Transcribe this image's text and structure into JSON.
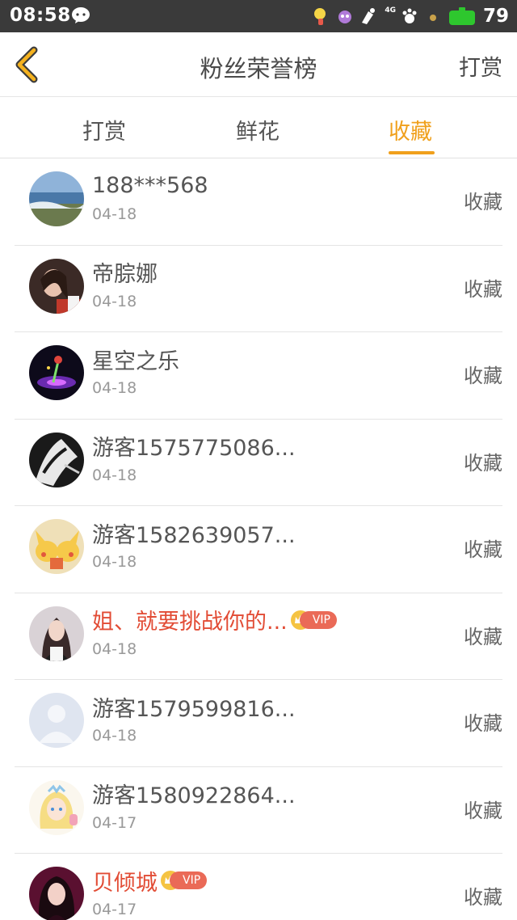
{
  "status_bar": {
    "time": "08:58",
    "network": "4G",
    "battery": "79",
    "colors": {
      "background": "#3a3a3a",
      "battery": "#2ec72e"
    }
  },
  "header": {
    "title": "粉丝荣誉榜",
    "action": "打赏"
  },
  "tabs": [
    {
      "label": "打赏",
      "active": false
    },
    {
      "label": "鲜花",
      "active": false
    },
    {
      "label": "收藏",
      "active": true
    }
  ],
  "accent_color": "#f0a01c",
  "vip_name_color": "#e24c35",
  "items": [
    {
      "name": "188***568",
      "date": "04-18",
      "action": "收藏",
      "vip": false,
      "vip_label": "",
      "avatar_icon": "seascape-avatar-icon"
    },
    {
      "name": "帝腙娜",
      "date": "04-18",
      "action": "收藏",
      "vip": false,
      "vip_label": "",
      "avatar_icon": "girl-portrait-avatar-icon"
    },
    {
      "name": "星空之乐",
      "date": "04-18",
      "action": "收藏",
      "vip": false,
      "vip_label": "",
      "avatar_icon": "starlight-avatar-icon"
    },
    {
      "name": "游客1575775086...",
      "date": "04-18",
      "action": "收藏",
      "vip": false,
      "vip_label": "",
      "avatar_icon": "dark-sketch-avatar-icon"
    },
    {
      "name": "游客1582639057...",
      "date": "04-18",
      "action": "收藏",
      "vip": false,
      "vip_label": "",
      "avatar_icon": "pikachu-avatar-icon"
    },
    {
      "name": "姐、就要挑战你的...",
      "date": "04-18",
      "action": "收藏",
      "vip": true,
      "vip_label": "VIP",
      "avatar_icon": "woman-photo-avatar-icon"
    },
    {
      "name": "游客1579599816...",
      "date": "04-18",
      "action": "收藏",
      "vip": false,
      "vip_label": "",
      "avatar_icon": "default-user-avatar-icon"
    },
    {
      "name": "游客1580922864...",
      "date": "04-17",
      "action": "收藏",
      "vip": false,
      "vip_label": "",
      "avatar_icon": "anime-girl-avatar-icon"
    },
    {
      "name": "贝倾城",
      "date": "04-17",
      "action": "收藏",
      "vip": true,
      "vip_label": "VIP",
      "avatar_icon": "dark-hair-woman-avatar-icon"
    }
  ]
}
